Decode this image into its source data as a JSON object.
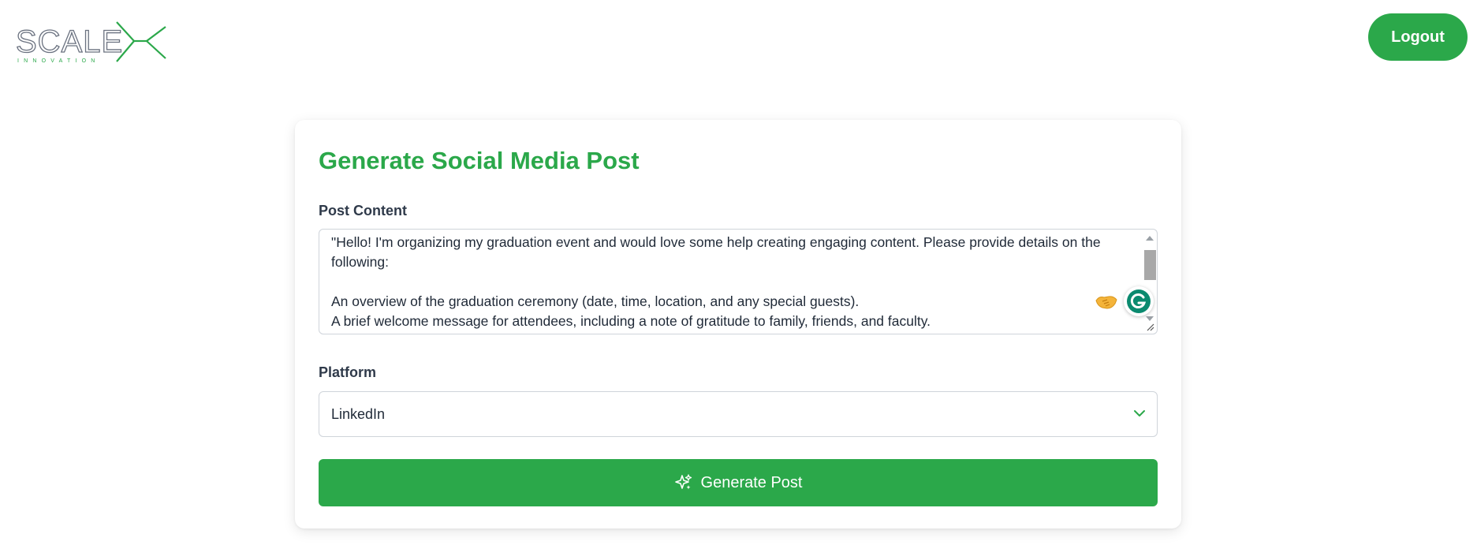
{
  "header": {
    "logo": {
      "text": "SCALE",
      "subtext": "INNOVATION",
      "brand_color": "#2ba84a",
      "text_color": "#6b7280"
    },
    "logout_label": "Logout"
  },
  "form": {
    "title": "Generate Social Media Post",
    "post_content": {
      "label": "Post Content",
      "value": "\"Hello! I'm organizing my graduation event and would love some help creating engaging content. Please provide details on the following:\n\nAn overview of the graduation ceremony (date, time, location, and any special guests).\nA brief welcome message for attendees, including a note of gratitude to family, friends, and faculty."
    },
    "platform": {
      "label": "Platform",
      "selected": "LinkedIn",
      "icon": "chevron-down-icon"
    },
    "generate_label": "Generate Post",
    "generate_icon": "sparkle-icon"
  },
  "extensions": {
    "handshake_icon": "handshake-icon",
    "grammarly_icon": "grammarly-icon"
  },
  "colors": {
    "accent": "#2ba84a",
    "background": "#ffffff",
    "border": "#cfd4da"
  }
}
